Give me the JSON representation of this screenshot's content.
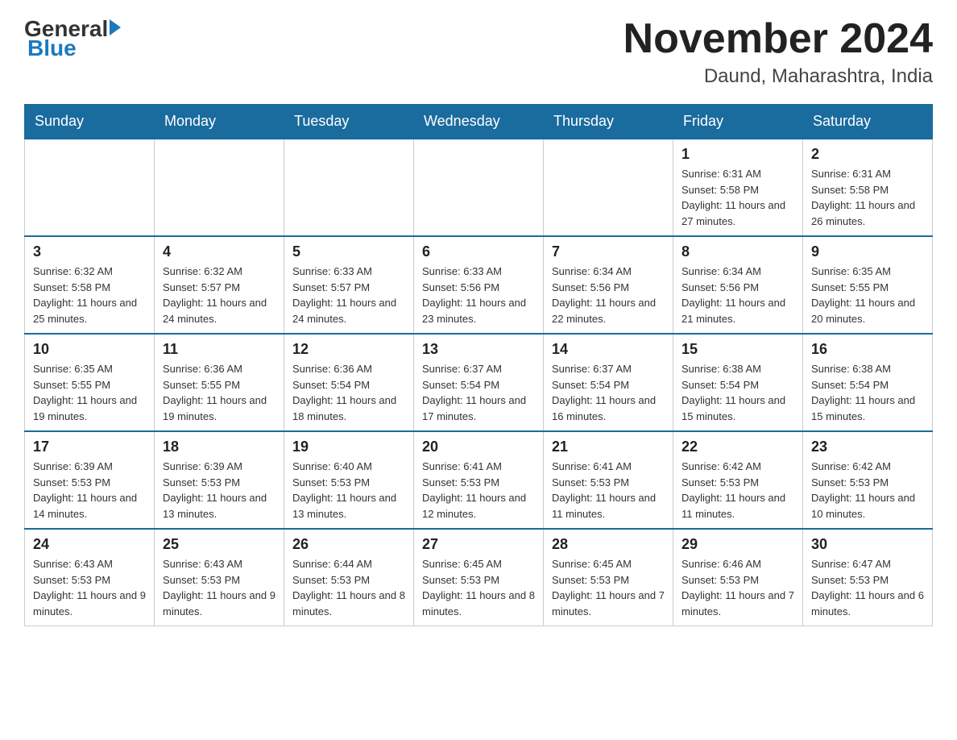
{
  "header": {
    "logo_general": "General",
    "logo_blue": "Blue",
    "month_title": "November 2024",
    "location": "Daund, Maharashtra, India"
  },
  "days_of_week": [
    "Sunday",
    "Monday",
    "Tuesday",
    "Wednesday",
    "Thursday",
    "Friday",
    "Saturday"
  ],
  "weeks": [
    [
      {
        "day": "",
        "info": "",
        "empty": true
      },
      {
        "day": "",
        "info": "",
        "empty": true
      },
      {
        "day": "",
        "info": "",
        "empty": true
      },
      {
        "day": "",
        "info": "",
        "empty": true
      },
      {
        "day": "",
        "info": "",
        "empty": true
      },
      {
        "day": "1",
        "info": "Sunrise: 6:31 AM\nSunset: 5:58 PM\nDaylight: 11 hours and 27 minutes."
      },
      {
        "day": "2",
        "info": "Sunrise: 6:31 AM\nSunset: 5:58 PM\nDaylight: 11 hours and 26 minutes."
      }
    ],
    [
      {
        "day": "3",
        "info": "Sunrise: 6:32 AM\nSunset: 5:58 PM\nDaylight: 11 hours and 25 minutes."
      },
      {
        "day": "4",
        "info": "Sunrise: 6:32 AM\nSunset: 5:57 PM\nDaylight: 11 hours and 24 minutes."
      },
      {
        "day": "5",
        "info": "Sunrise: 6:33 AM\nSunset: 5:57 PM\nDaylight: 11 hours and 24 minutes."
      },
      {
        "day": "6",
        "info": "Sunrise: 6:33 AM\nSunset: 5:56 PM\nDaylight: 11 hours and 23 minutes."
      },
      {
        "day": "7",
        "info": "Sunrise: 6:34 AM\nSunset: 5:56 PM\nDaylight: 11 hours and 22 minutes."
      },
      {
        "day": "8",
        "info": "Sunrise: 6:34 AM\nSunset: 5:56 PM\nDaylight: 11 hours and 21 minutes."
      },
      {
        "day": "9",
        "info": "Sunrise: 6:35 AM\nSunset: 5:55 PM\nDaylight: 11 hours and 20 minutes."
      }
    ],
    [
      {
        "day": "10",
        "info": "Sunrise: 6:35 AM\nSunset: 5:55 PM\nDaylight: 11 hours and 19 minutes."
      },
      {
        "day": "11",
        "info": "Sunrise: 6:36 AM\nSunset: 5:55 PM\nDaylight: 11 hours and 19 minutes."
      },
      {
        "day": "12",
        "info": "Sunrise: 6:36 AM\nSunset: 5:54 PM\nDaylight: 11 hours and 18 minutes."
      },
      {
        "day": "13",
        "info": "Sunrise: 6:37 AM\nSunset: 5:54 PM\nDaylight: 11 hours and 17 minutes."
      },
      {
        "day": "14",
        "info": "Sunrise: 6:37 AM\nSunset: 5:54 PM\nDaylight: 11 hours and 16 minutes."
      },
      {
        "day": "15",
        "info": "Sunrise: 6:38 AM\nSunset: 5:54 PM\nDaylight: 11 hours and 15 minutes."
      },
      {
        "day": "16",
        "info": "Sunrise: 6:38 AM\nSunset: 5:54 PM\nDaylight: 11 hours and 15 minutes."
      }
    ],
    [
      {
        "day": "17",
        "info": "Sunrise: 6:39 AM\nSunset: 5:53 PM\nDaylight: 11 hours and 14 minutes."
      },
      {
        "day": "18",
        "info": "Sunrise: 6:39 AM\nSunset: 5:53 PM\nDaylight: 11 hours and 13 minutes."
      },
      {
        "day": "19",
        "info": "Sunrise: 6:40 AM\nSunset: 5:53 PM\nDaylight: 11 hours and 13 minutes."
      },
      {
        "day": "20",
        "info": "Sunrise: 6:41 AM\nSunset: 5:53 PM\nDaylight: 11 hours and 12 minutes."
      },
      {
        "day": "21",
        "info": "Sunrise: 6:41 AM\nSunset: 5:53 PM\nDaylight: 11 hours and 11 minutes."
      },
      {
        "day": "22",
        "info": "Sunrise: 6:42 AM\nSunset: 5:53 PM\nDaylight: 11 hours and 11 minutes."
      },
      {
        "day": "23",
        "info": "Sunrise: 6:42 AM\nSunset: 5:53 PM\nDaylight: 11 hours and 10 minutes."
      }
    ],
    [
      {
        "day": "24",
        "info": "Sunrise: 6:43 AM\nSunset: 5:53 PM\nDaylight: 11 hours and 9 minutes."
      },
      {
        "day": "25",
        "info": "Sunrise: 6:43 AM\nSunset: 5:53 PM\nDaylight: 11 hours and 9 minutes."
      },
      {
        "day": "26",
        "info": "Sunrise: 6:44 AM\nSunset: 5:53 PM\nDaylight: 11 hours and 8 minutes."
      },
      {
        "day": "27",
        "info": "Sunrise: 6:45 AM\nSunset: 5:53 PM\nDaylight: 11 hours and 8 minutes."
      },
      {
        "day": "28",
        "info": "Sunrise: 6:45 AM\nSunset: 5:53 PM\nDaylight: 11 hours and 7 minutes."
      },
      {
        "day": "29",
        "info": "Sunrise: 6:46 AM\nSunset: 5:53 PM\nDaylight: 11 hours and 7 minutes."
      },
      {
        "day": "30",
        "info": "Sunrise: 6:47 AM\nSunset: 5:53 PM\nDaylight: 11 hours and 6 minutes."
      }
    ]
  ]
}
